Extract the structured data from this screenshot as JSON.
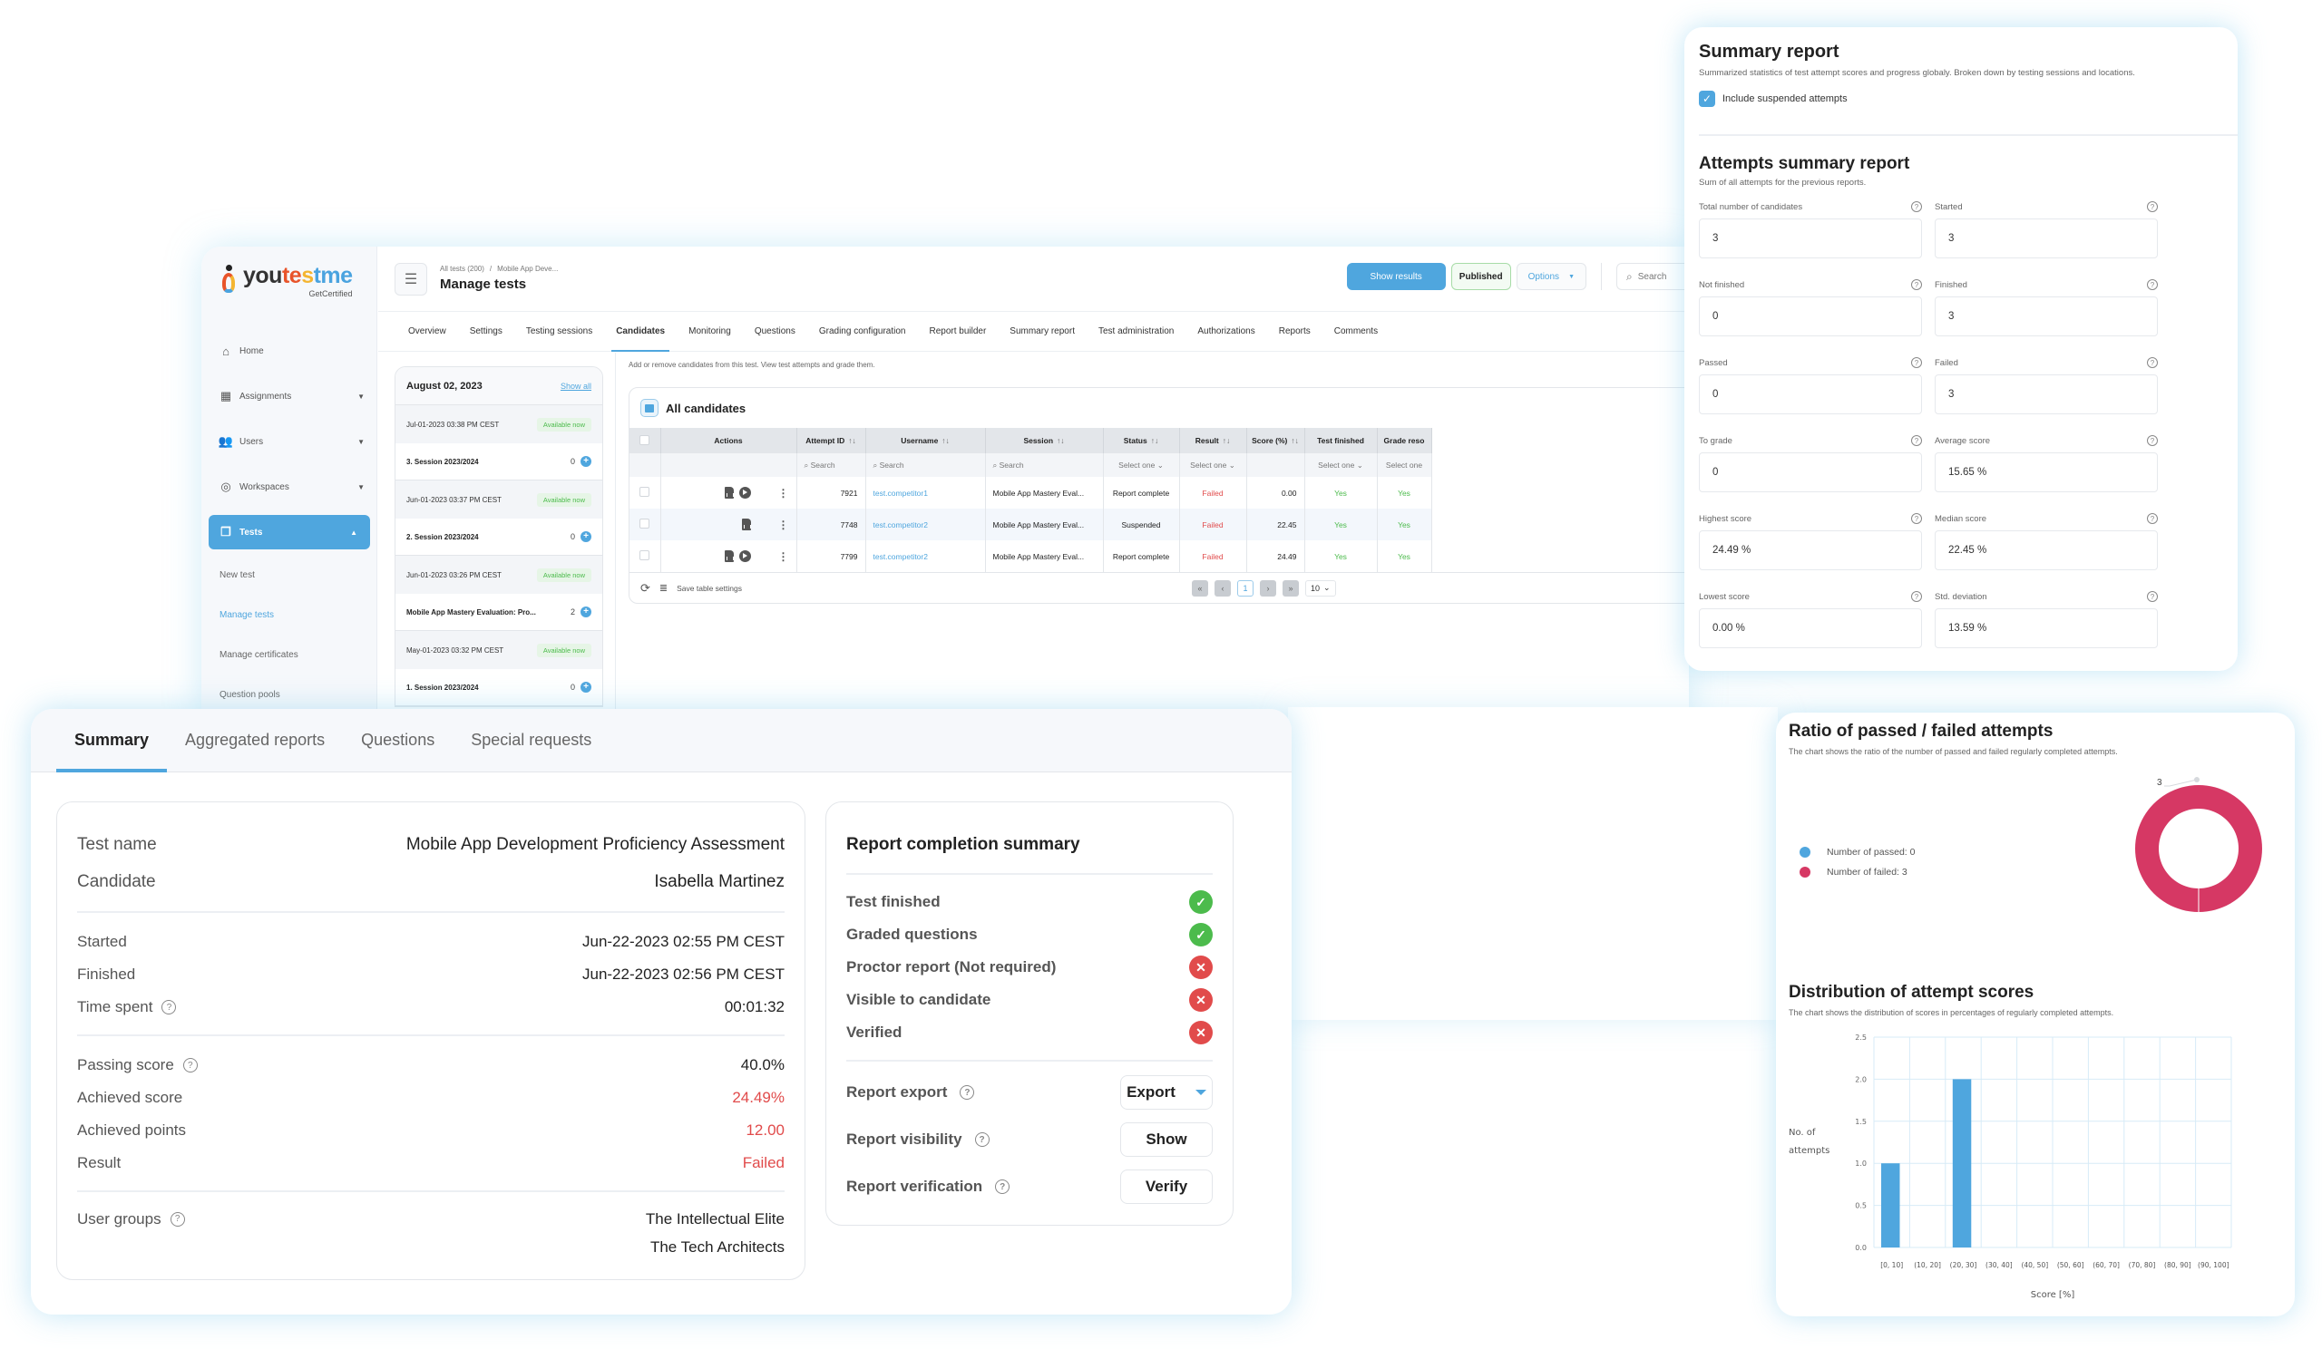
{
  "manage_tests": {
    "logo": {
      "name_part1": "you",
      "name_part2": "te",
      "name_part3": "s",
      "name_part4": "tme",
      "tagline": "GetCertified"
    },
    "sidebar": {
      "items": [
        {
          "label": "Home",
          "icon": "home-icon",
          "expandable": false
        },
        {
          "label": "Assignments",
          "icon": "assignments-icon",
          "expandable": true
        },
        {
          "label": "Users",
          "icon": "users-icon",
          "expandable": true
        },
        {
          "label": "Workspaces",
          "icon": "globe-icon",
          "expandable": true
        },
        {
          "label": "Tests",
          "icon": "tests-icon",
          "expandable": true,
          "active": true
        }
      ],
      "sub_items": [
        {
          "label": "New test"
        },
        {
          "label": "Manage tests",
          "current": true
        },
        {
          "label": "Manage certificates"
        },
        {
          "label": "Question pools"
        }
      ]
    },
    "header": {
      "breadcrumb": [
        "All tests (200)",
        "Mobile App Deve..."
      ],
      "breadcrumb_sep": "/",
      "title": "Manage tests",
      "show_results": "Show results",
      "published": "Published",
      "options": "Options",
      "search": "Search"
    },
    "tabs": [
      "Overview",
      "Settings",
      "Testing sessions",
      "Candidates",
      "Monitoring",
      "Questions",
      "Grading configuration",
      "Report builder",
      "Summary report",
      "Test administration",
      "Authorizations",
      "Reports",
      "Comments"
    ],
    "active_tab": "Candidates",
    "sessions": {
      "date": "August 02, 2023",
      "show_all": "Show all",
      "groups": [
        {
          "time": "Jul-01-2023 03:38 PM CEST",
          "badge": "Available now",
          "name": "3. Session 2023/2024",
          "count": "0"
        },
        {
          "time": "Jun-01-2023 03:37 PM CEST",
          "badge": "Available now",
          "name": "2. Session 2023/2024",
          "count": "0"
        },
        {
          "time": "Jun-01-2023 03:26 PM CEST",
          "badge": "Available now",
          "name": "Mobile App Mastery Evaluation: Pro...",
          "count": "2"
        },
        {
          "time": "May-01-2023 03:32 PM CEST",
          "badge": "Available now",
          "name": "1. Session 2023/2024",
          "count": "0"
        }
      ]
    },
    "candidates": {
      "description": "Add or remove candidates from this test. View test attempts and grade them.",
      "title": "All candidates",
      "columns": [
        "Actions",
        "Attempt ID",
        "Username",
        "Session",
        "Status",
        "Result",
        "Score (%)",
        "Test finished",
        "Grade reso"
      ],
      "filters": {
        "search": "Search",
        "select": "Select one"
      },
      "rows": [
        {
          "attempt_id": "7921",
          "username": "test.competitor1",
          "session": "Mobile App Mastery Eval...",
          "status": "Report complete",
          "result": "Failed",
          "score": "0.00",
          "finished": "Yes",
          "grade": "Yes",
          "has_play": true
        },
        {
          "attempt_id": "7748",
          "username": "test.competitor2",
          "session": "Mobile App Mastery Eval...",
          "status": "Suspended",
          "result": "Failed",
          "score": "22.45",
          "finished": "Yes",
          "grade": "Yes",
          "has_play": false
        },
        {
          "attempt_id": "7799",
          "username": "test.competitor2",
          "session": "Mobile App Mastery Eval...",
          "status": "Report complete",
          "result": "Failed",
          "score": "24.49",
          "finished": "Yes",
          "grade": "Yes",
          "has_play": true
        }
      ],
      "save_settings": "Save table settings",
      "pager": {
        "first": "«",
        "prev": "‹",
        "page": "1",
        "next": "›",
        "last": "»",
        "page_size": "10"
      }
    }
  },
  "summary_report": {
    "title": "Summary report",
    "description": "Summarized statistics of test attempt scores and progress globaly. Broken down by testing sessions and locations.",
    "include_suspended_label": "Include suspended attempts",
    "include_suspended": true,
    "attempts_title": "Attempts summary report",
    "attempts_description": "Sum of all attempts for the previous reports.",
    "stats": [
      {
        "label": "Total number of candidates",
        "value": "3"
      },
      {
        "label": "Started",
        "value": "3"
      },
      {
        "label": "Not finished",
        "value": "0"
      },
      {
        "label": "Finished",
        "value": "3"
      },
      {
        "label": "Passed",
        "value": "0"
      },
      {
        "label": "Failed",
        "value": "3"
      },
      {
        "label": "To grade",
        "value": "0"
      },
      {
        "label": "Average score",
        "value": "15.65 %"
      },
      {
        "label": "Highest score",
        "value": "24.49 %"
      },
      {
        "label": "Median score",
        "value": "22.45 %"
      },
      {
        "label": "Lowest score",
        "value": "0.00 %"
      },
      {
        "label": "Std. deviation",
        "value": "13.59 %"
      }
    ]
  },
  "result_summary": {
    "tabs": [
      "Summary",
      "Aggregated reports",
      "Questions",
      "Special requests"
    ],
    "active_tab": "Summary",
    "test_name_label": "Test name",
    "test_name": "Mobile App Development Proficiency Assessment",
    "candidate_label": "Candidate",
    "candidate": "Isabella Martinez",
    "started_label": "Started",
    "started": "Jun-22-2023 02:55 PM CEST",
    "finished_label": "Finished",
    "finished": "Jun-22-2023 02:56 PM CEST",
    "time_spent_label": "Time spent",
    "time_spent": "00:01:32",
    "passing_score_label": "Passing score",
    "passing_score": "40.0%",
    "achieved_score_label": "Achieved score",
    "achieved_score": "24.49%",
    "achieved_points_label": "Achieved points",
    "achieved_points": "12.00",
    "result_label": "Result",
    "result": "Failed",
    "user_groups_label": "User groups",
    "user_groups": [
      "The Intellectual Elite",
      "The Tech Architects"
    ],
    "completion": {
      "title": "Report completion summary",
      "items": [
        {
          "label": "Test finished",
          "done": true
        },
        {
          "label": "Graded questions",
          "done": true
        },
        {
          "label": "Proctor report (Not required)",
          "done": false
        },
        {
          "label": "Visible to candidate",
          "done": false
        },
        {
          "label": "Verified",
          "done": false
        }
      ],
      "actions": [
        {
          "label": "Report export",
          "button": "Export",
          "dropdown": true
        },
        {
          "label": "Report visibility",
          "button": "Show",
          "dropdown": false
        },
        {
          "label": "Report verification",
          "button": "Verify",
          "dropdown": false
        }
      ]
    }
  },
  "colors": {
    "accent": "#4fa6de",
    "passed": "#4fa6de",
    "failed": "#d63864",
    "success": "#4cbb4c",
    "error": "#e14b4b"
  },
  "chart_data": [
    {
      "type": "pie",
      "title": "Ratio of passed / failed attempts",
      "subtitle": "The chart shows the ratio of the number of passed and failed regularly completed attempts.",
      "categories": [
        "Number of passed",
        "Number of failed"
      ],
      "values": [
        0,
        3
      ],
      "legend": [
        "Number of passed: 0",
        "Number of failed: 3"
      ],
      "data_label": "3",
      "donut": true,
      "legend_position": "left"
    },
    {
      "type": "bar",
      "title": "Distribution of attempt scores",
      "subtitle": "The chart shows the distribution of scores in percentages of regularly completed attempts.",
      "categories": [
        "[0, 10]",
        "(10, 20]",
        "(20, 30]",
        "(30, 40]",
        "(40, 50]",
        "(50, 60]",
        "(60, 70]",
        "(70, 80]",
        "(80, 90]",
        "(90, 100]"
      ],
      "values": [
        1,
        0,
        2,
        0,
        0,
        0,
        0,
        0,
        0,
        0
      ],
      "xlabel": "Score [%]",
      "ylabel": "No. of attempts",
      "ylim": [
        0,
        2.5
      ],
      "yticks": [
        "0.0",
        "0.5",
        "1.0",
        "1.5",
        "2.0",
        "2.5"
      ],
      "grid": true
    }
  ]
}
